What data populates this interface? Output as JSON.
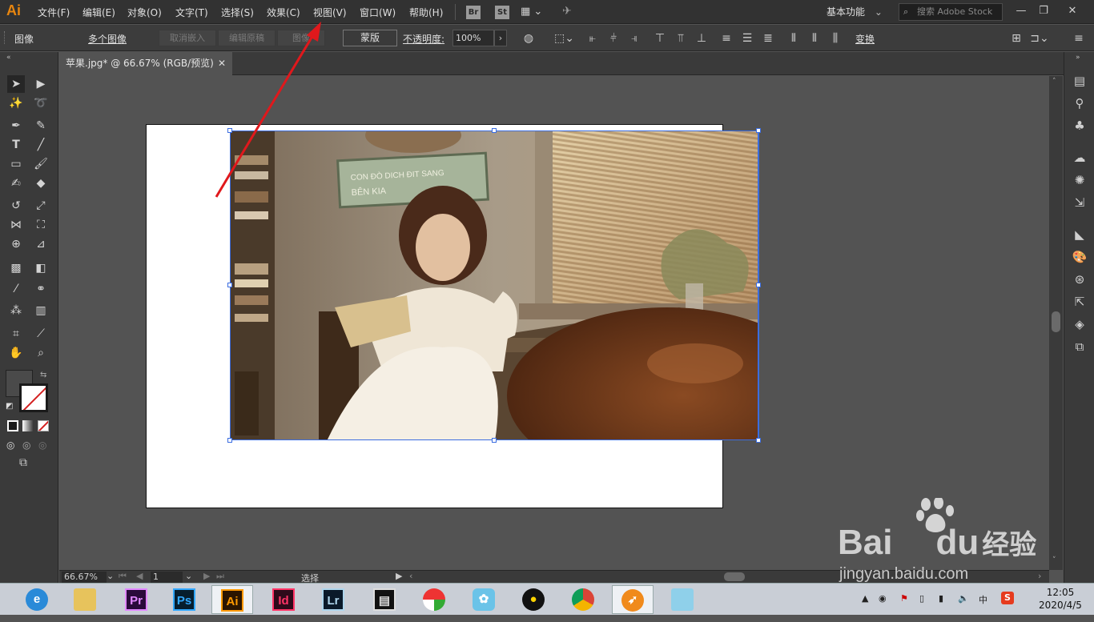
{
  "app": {
    "logo": "Ai",
    "menu": [
      "文件(F)",
      "编辑(E)",
      "对象(O)",
      "文字(T)",
      "选择(S)",
      "效果(C)",
      "视图(V)",
      "窗口(W)",
      "帮助(H)"
    ],
    "bridge_label": "Br",
    "stock_label": "St",
    "workspace": "基本功能",
    "search_placeholder": "搜索 Adobe Stock"
  },
  "control_bar": {
    "object_type": "图像",
    "multi_image": "多个图像",
    "unembed": "取消嵌入",
    "edit_original": "编辑原稿",
    "image_trace": "图像",
    "mask": "蒙版",
    "opacity_label": "不透明度:",
    "opacity_value": "100%",
    "transform": "变换"
  },
  "document": {
    "tab_title": "苹果.jpg* @ 66.67% (RGB/预览)"
  },
  "photo": {
    "sign_line1": "CON ĐÒ DICH ĐIT SANG",
    "sign_line2": "BÊN KIA"
  },
  "status_bar": {
    "zoom": "66.67%",
    "artboard_number": "1",
    "tool_status": "选择"
  },
  "taskbar": {
    "apps": [
      "Pr",
      "Ps",
      "Ai",
      "Id",
      "Lr"
    ],
    "tray_ime": "中",
    "time": "12:05",
    "date": "2020/4/5"
  },
  "watermark": {
    "brand": "Bai",
    "brand2": "du",
    "suffix": "经验",
    "url": "jingyan.baidu.com"
  },
  "colors": {
    "accent_ai": "#e8860f",
    "selection_blue": "#3b6de0",
    "arrow_red": "#e0181c"
  }
}
